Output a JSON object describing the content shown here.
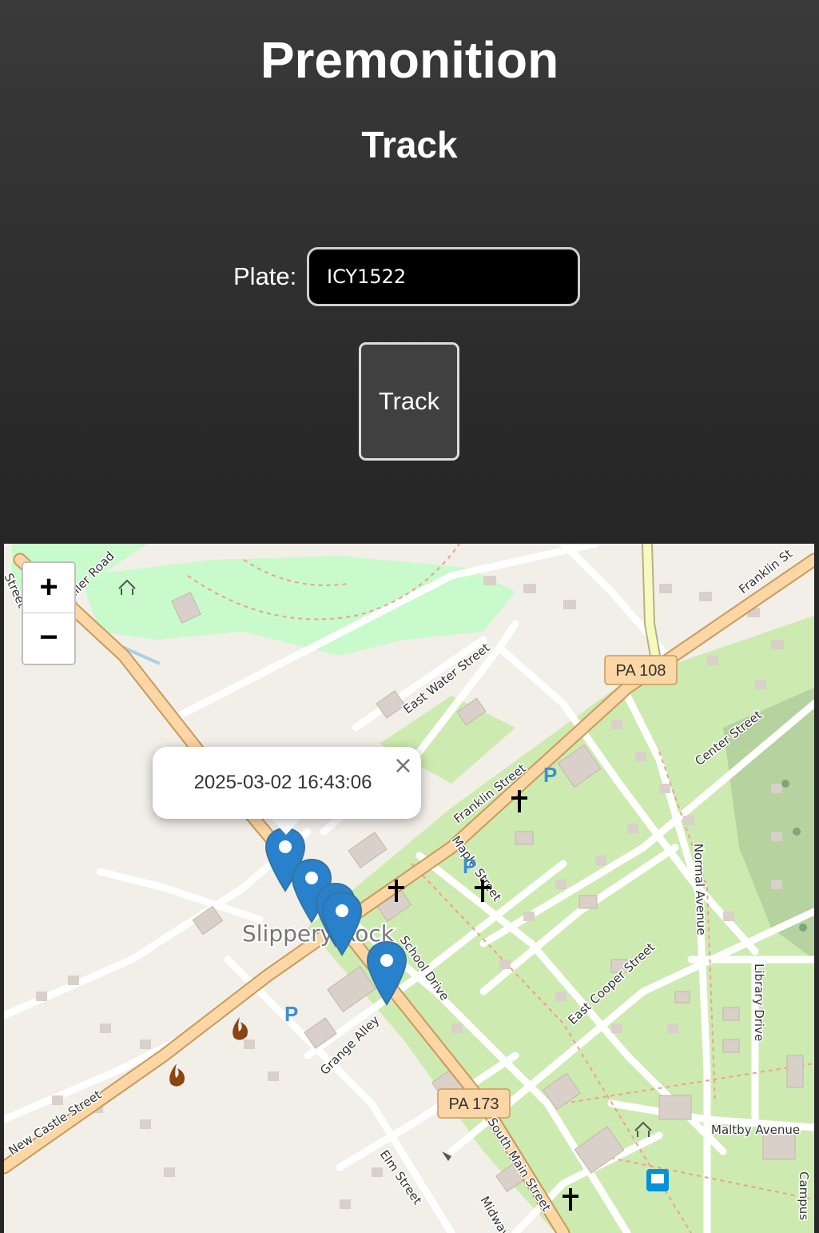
{
  "header": {
    "app_title": "Premonition",
    "section_title": "Track"
  },
  "form": {
    "plate_label": "Plate:",
    "plate_value": "ICY1522",
    "track_button_label": "Track"
  },
  "map": {
    "zoom_in_label": "+",
    "zoom_out_label": "−",
    "popup": {
      "text": "2025-03-02 16:43:06",
      "close_label": "×"
    },
    "marker_count": 5,
    "town_label": "Slippery Rock",
    "route_shields": [
      "PA 108",
      "PA 173"
    ],
    "street_labels": [
      "East Water Street",
      "Franklin Street",
      "Franklin St",
      "Center Street",
      "Maple Street",
      "School Drive",
      "East Cooper Street",
      "Normal Avenue",
      "Library Drive",
      "Maltby Avenue",
      "Grange Alley",
      "New Castle Street",
      "South Main Street",
      "Elm Street",
      "Midway",
      "Campus",
      "Street",
      "Miller Road"
    ],
    "colors": {
      "land": "#f2efe9",
      "park": "#c8facc",
      "residential_green": "#cdebb0",
      "building": "#d9d0c9",
      "primary_road": "#fcd6a4",
      "trunk_road": "#f7fabf",
      "marker": "#2a81cb",
      "parking_icon": "#3b8fd6"
    }
  }
}
